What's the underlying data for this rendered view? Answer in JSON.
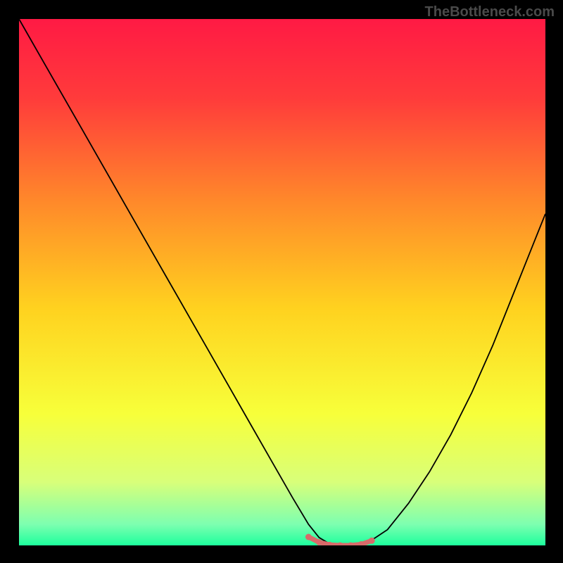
{
  "watermark": "TheBottleneck.com",
  "chart_data": {
    "type": "line",
    "title": "",
    "xlabel": "",
    "ylabel": "",
    "xlim": [
      0,
      100
    ],
    "ylim": [
      0,
      100
    ],
    "background_gradient": {
      "stops": [
        {
          "offset": 0.0,
          "color": "#ff1a44"
        },
        {
          "offset": 0.15,
          "color": "#ff3b3b"
        },
        {
          "offset": 0.35,
          "color": "#ff8a2a"
        },
        {
          "offset": 0.55,
          "color": "#ffd21f"
        },
        {
          "offset": 0.75,
          "color": "#f7ff3a"
        },
        {
          "offset": 0.88,
          "color": "#d8ff7a"
        },
        {
          "offset": 0.96,
          "color": "#7dffb0"
        },
        {
          "offset": 1.0,
          "color": "#1dff9d"
        }
      ]
    },
    "series": [
      {
        "name": "curve",
        "color": "#000000",
        "x": [
          0,
          4,
          8,
          12,
          16,
          20,
          24,
          28,
          32,
          36,
          40,
          44,
          48,
          52,
          55,
          57,
          59,
          61,
          63,
          65,
          67,
          70,
          74,
          78,
          82,
          86,
          90,
          94,
          98,
          100
        ],
        "values": [
          100,
          93,
          86,
          79,
          72,
          65,
          58,
          51,
          44,
          37,
          30,
          23,
          16,
          9,
          4,
          1.5,
          0.3,
          0,
          0,
          0.2,
          1,
          3,
          8,
          14,
          21,
          29,
          38,
          48,
          58,
          63
        ]
      },
      {
        "name": "flat-highlight",
        "color": "#d86a6a",
        "thick": true,
        "x": [
          55,
          57,
          59,
          61,
          63,
          65,
          67
        ],
        "values": [
          1.6,
          0.6,
          0.1,
          0,
          0,
          0.2,
          0.9
        ]
      }
    ]
  }
}
